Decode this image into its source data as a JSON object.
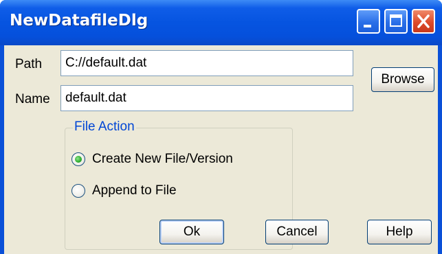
{
  "window": {
    "title": "NewDatafileDlg"
  },
  "form": {
    "path_label": "Path",
    "path_value": "C://default.dat",
    "name_label": "Name",
    "name_value": "default.dat",
    "browse_label": "Browse"
  },
  "file_action": {
    "legend": "File Action",
    "options": [
      {
        "label": "Create New File/Version",
        "selected": true
      },
      {
        "label": "Append to File",
        "selected": false
      }
    ]
  },
  "buttons": {
    "ok": "Ok",
    "cancel": "Cancel",
    "help": "Help"
  },
  "colors": {
    "titlebar": "#0654e0",
    "client": "#ece9d8",
    "legend": "#0046d5",
    "close": "#dd4b2a"
  }
}
